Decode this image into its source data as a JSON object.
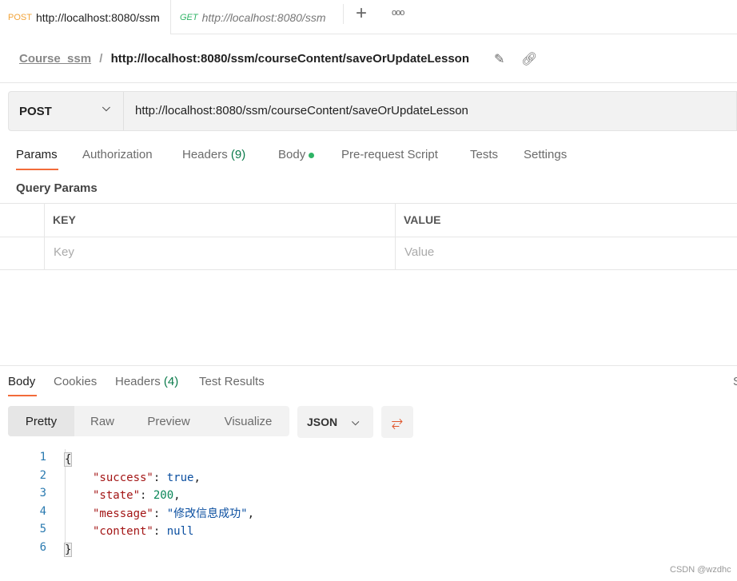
{
  "tabs": [
    {
      "method": "POST",
      "url": "http://localhost:8080/ssm",
      "active": true
    },
    {
      "method": "GET",
      "url": "http://localhost:8080/ssm",
      "active": false
    }
  ],
  "icons": {
    "new_tab": "plus-icon",
    "more": "more-icon",
    "edit": "pencil-icon",
    "link": "link-icon",
    "wrap": "wrap-lines-icon"
  },
  "breadcrumb": {
    "collection": "Course_ssm",
    "separator": "/",
    "request": "http://localhost:8080/ssm/courseContent/saveOrUpdateLesson"
  },
  "request": {
    "method": "POST",
    "url": "http://localhost:8080/ssm/courseContent/saveOrUpdateLesson"
  },
  "request_tabs": [
    {
      "label": "Params",
      "active": true
    },
    {
      "label": "Authorization"
    },
    {
      "label": "Headers",
      "count": "(9)"
    },
    {
      "label": "Body",
      "dot": true
    },
    {
      "label": "Pre-request Script"
    },
    {
      "label": "Tests"
    },
    {
      "label": "Settings"
    }
  ],
  "query_params": {
    "title": "Query Params",
    "columns": [
      "KEY",
      "VALUE"
    ],
    "placeholders": {
      "key": "Key",
      "value": "Value"
    }
  },
  "response_tabs": [
    {
      "label": "Body",
      "active": true
    },
    {
      "label": "Cookies"
    },
    {
      "label": "Headers",
      "count": "(4)"
    },
    {
      "label": "Test Results"
    }
  ],
  "response_tabs_overflow": "S",
  "view_modes": [
    "Pretty",
    "Raw",
    "Preview",
    "Visualize"
  ],
  "active_view": "Pretty",
  "format": "JSON",
  "code_lines": [
    "1",
    "2",
    "3",
    "4",
    "5",
    "6"
  ],
  "response": {
    "open": "{",
    "close": "}",
    "k1": "\"success\"",
    "v1": "true",
    "k2": "\"state\"",
    "v2": "200",
    "k3": "\"message\"",
    "v3": "\"修改信息成功\"",
    "k4": "\"content\"",
    "v4": "null"
  },
  "watermark": "CSDN @wzdhc",
  "colors": {
    "accent": "#f26b3a",
    "post": "#f2a43a",
    "get": "#2fb466",
    "count": "#0a7a4a"
  }
}
